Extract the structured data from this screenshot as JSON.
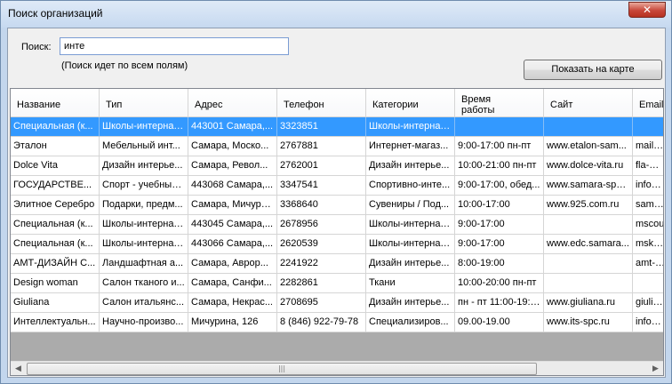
{
  "window": {
    "title": "Поиск организаций",
    "close_glyph": "✕"
  },
  "search": {
    "label": "Поиск:",
    "value": "инте",
    "hint": "(Поиск идет по всем полям)"
  },
  "map_button": {
    "label": "Показать на карте"
  },
  "table": {
    "columns": [
      "Название",
      "Тип",
      "Адрес",
      "Телефон",
      "Категории",
      "Время\nработы",
      "Сайт",
      "Email"
    ],
    "rows": [
      [
        "Специальная (к...",
        "Школы-интернаты",
        "443001 Самара,...",
        "3323851",
        "Школы-интернаты",
        "",
        "",
        ""
      ],
      [
        "Эталон",
        "Мебельный инт...",
        "Самара, Моско...",
        "2767881",
        "Интернет-магаз...",
        "9:00-17:00 пн-пт",
        "www.etalon-sam...",
        "mail@e"
      ],
      [
        "Dolce Vita",
        "Дизайн интерье...",
        "Самара, Револ...",
        "2762001",
        "Дизайн интерье...",
        "10:00-21:00 пн-пт",
        "www.dolce-vita.ru",
        "fla-meb"
      ],
      [
        "ГОСУДАРСТВЕ...",
        "Спорт - учебные...",
        "443068 Самара,...",
        "3347541",
        "Спортивно-инте...",
        "9:00-17:00, обед...",
        "www.samara-spo...",
        "info@sa"
      ],
      [
        "Элитное Серебро",
        "Подарки, предм...",
        "Самара, Мичури...",
        "3368640",
        "Сувениры / Под...",
        "10:00-17:00",
        "www.925.com.ru",
        "samara"
      ],
      [
        "Специальная (к...",
        "Школы-интернаты",
        "443045 Самара,...",
        "2678956",
        "Школы-интернаты",
        "9:00-17:00",
        "",
        "mscou"
      ],
      [
        "Специальная (к...",
        "Школы-интернаты",
        "443066 Самара,...",
        "2620539",
        "Школы-интернаты",
        "9:00-17:00",
        "www.edc.samara...",
        "mskou_"
      ],
      [
        "АМТ-ДИЗАЙН С...",
        "Ландшафтная а...",
        "Самара, Авроp...",
        "2241922",
        "Дизайн интерье...",
        "8:00-19:00",
        "",
        "amt-des"
      ],
      [
        "Design woman",
        "Салон тканого и...",
        "Самара, Санфи...",
        "2282861",
        "Ткани",
        "10:00-20:00 пн-пт",
        "",
        ""
      ],
      [
        "Giuliana",
        "Салон итальянс...",
        "Самара, Некрас...",
        "2708695",
        "Дизайн интерье...",
        "пн - пт 11:00-19:00",
        "www.giuliana.ru",
        "giuliana"
      ],
      [
        "Интеллектуальн...",
        "Научно-произво...",
        "Мичурина, 126",
        "8 (846) 922-79-78",
        "Специализиров...",
        "09.00-19.00",
        "www.its-spc.ru",
        "info@its"
      ]
    ]
  },
  "scrollbar": {
    "left_arrow": "◀",
    "right_arrow": "▶",
    "thumb_grip": "|||"
  }
}
